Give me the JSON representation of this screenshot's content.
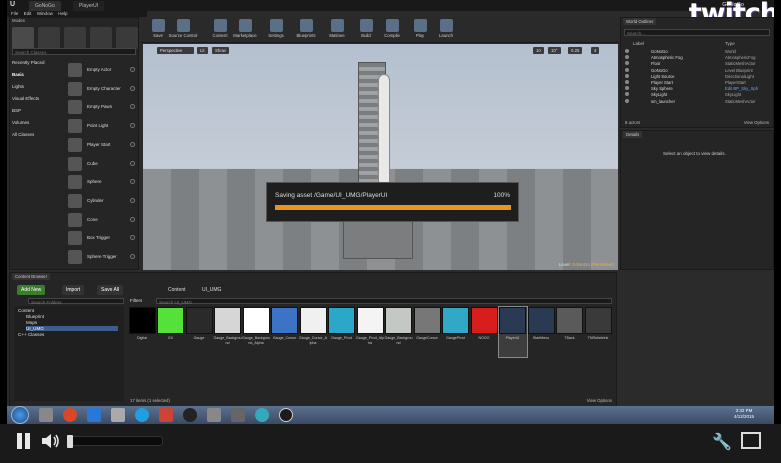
{
  "title_bar": {
    "tabs": [
      "GoNoGo",
      "PlayerUI"
    ],
    "project_name": "GoNoGo",
    "overlay_logo": "twitch"
  },
  "menu": [
    "File",
    "Edit",
    "Window",
    "Help"
  ],
  "modes_panel": {
    "tab": "Modes",
    "search_placeholder": "Search Classes",
    "categories": [
      "Recently Placed",
      "Basic",
      "Lights",
      "Visual Effects",
      "BSP",
      "Volumes",
      "All Classes"
    ],
    "selected_category": "Basic",
    "items": [
      "Empty Actor",
      "Empty Character",
      "Empty Pawn",
      "Point Light",
      "Player Start",
      "Cube",
      "Sphere",
      "Cylinder",
      "Cone",
      "Box Trigger",
      "Sphere Trigger"
    ]
  },
  "toolbar": {
    "buttons": [
      "Save",
      "Source Control",
      "Content",
      "Marketplace",
      "Settings",
      "Blueprints",
      "Matinee",
      "Build",
      "Compile",
      "Play",
      "Launch"
    ]
  },
  "viewport": {
    "view_buttons": [
      "Perspective",
      "Lit",
      "Show"
    ],
    "snap_values": [
      "10",
      "10°",
      "0.25",
      "4"
    ],
    "level_label": "Level:",
    "level_name": "GoNoGo (Persistent)"
  },
  "save_dialog": {
    "message": "Saving asset /Game/UI_UMG/PlayerUI",
    "percent_text": "100%",
    "progress": 1.0,
    "bar_color": "#e6951f"
  },
  "world_outliner": {
    "tab": "World Outliner",
    "search_placeholder": "Search...",
    "columns": [
      "Label",
      "Type"
    ],
    "rows": [
      {
        "label": "GoNoGo",
        "type": "World",
        "link": false
      },
      {
        "label": "Atmospheric Fog",
        "type": "AtmosphericFog",
        "link": false
      },
      {
        "label": "Floor",
        "type": "StaticMeshActor",
        "link": false
      },
      {
        "label": "GoNoGo",
        "type": "Level Blueprint",
        "link": false
      },
      {
        "label": "Light Source",
        "type": "DirectionalLight",
        "link": false
      },
      {
        "label": "Player Start",
        "type": "PlayerStart",
        "link": false
      },
      {
        "label": "Sky Sphere",
        "type": "Edit BP_Sky_Sph",
        "link": true
      },
      {
        "label": "SkyLight",
        "type": "SkyLight",
        "link": false
      },
      {
        "label": "sm_launcher",
        "type": "StaticMeshActor",
        "link": false
      }
    ],
    "actor_count": "8 actors",
    "view_options": "View Options"
  },
  "details": {
    "tab": "Details",
    "empty_message": "Select an object to view details."
  },
  "content_browser": {
    "tab": "Content Browser",
    "add_new": "Add New",
    "import": "Import",
    "save_all": "Save All",
    "breadcrumb": [
      "Content",
      "UI_UMG"
    ],
    "folder_search_placeholder": "Search Folders",
    "filters_label": "Filters",
    "asset_search_placeholder": "Search UI_UMG",
    "tree": [
      {
        "label": "Content",
        "indent": 0,
        "selected": false
      },
      {
        "label": "Blueprint",
        "indent": 1,
        "selected": false
      },
      {
        "label": "Maps",
        "indent": 1,
        "selected": false
      },
      {
        "label": "UI_UMG",
        "indent": 1,
        "selected": true
      },
      {
        "label": "C++ Classes",
        "indent": 0,
        "selected": false
      }
    ],
    "assets": [
      {
        "name": "Digital",
        "color": "#000000"
      },
      {
        "name": "GX",
        "color": "#55e03a"
      },
      {
        "name": "Gauge",
        "color": "#2a2a2a"
      },
      {
        "name": "Gauge_Background",
        "color": "#d6d6d6"
      },
      {
        "name": "Gauge_Background_Alpha",
        "color": "#ffffff"
      },
      {
        "name": "Gauge_Cursor",
        "color": "#3b74c4"
      },
      {
        "name": "Gauge_Cursor_Alpha",
        "color": "#f0f0f0"
      },
      {
        "name": "Gauge_Pivot",
        "color": "#2aa7c9"
      },
      {
        "name": "Gauge_Pivot_Alpha",
        "color": "#f4f4f4"
      },
      {
        "name": "Gauge_Background",
        "color": "#c4c8c4"
      },
      {
        "name": "GaugeCursor",
        "color": "#777777"
      },
      {
        "name": "GaugePivot",
        "color": "#32a8c7"
      },
      {
        "name": "NOGO",
        "color": "#d81d1d"
      },
      {
        "name": "PlayerUI",
        "color": "#2a3a52"
      },
      {
        "name": "StartMenu",
        "color": "#2a3a52"
      },
      {
        "name": "TBack",
        "color": "#5a5a5a"
      },
      {
        "name": "TNReticleInk",
        "color": "#3a3a3a"
      }
    ],
    "selected_asset": "PlayerUI",
    "items_count": "17 items (1 selected)",
    "view_options": "View Options"
  },
  "taskbar": {
    "time": "3:32 PM",
    "date": "4/12/2015"
  }
}
